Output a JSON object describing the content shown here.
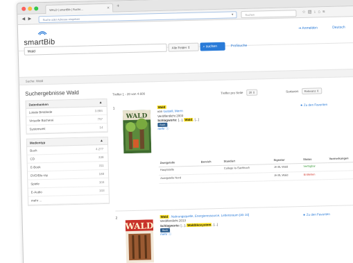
{
  "browser": {
    "tab_title": "WALD | smartBib | Suche...",
    "url_placeholder": "Suche oder Adresse eingeben",
    "search_placeholder": "Suchen"
  },
  "header": {
    "logo_text": "smartBib",
    "links": [
      "Anmelden",
      "Deutsch"
    ]
  },
  "search": {
    "query": "Wald",
    "field": "Alle Felder",
    "button": "suchen",
    "profi_link": "Profisuche"
  },
  "breadcrumb": "Suche: Wald",
  "results": {
    "heading": "Suchergebnisse Wald",
    "hits_info": "Treffer 1 - 20 von 4.600",
    "per_page_label": "Treffer pro Seite",
    "per_page_value": "20",
    "sort_label": "Sortieren",
    "sort_value": "Relevanz"
  },
  "facets": {
    "location": {
      "title": "Datenbanken",
      "items": [
        {
          "label": "Lokale Bestände",
          "count": "3.884"
        },
        {
          "label": "Virtuelle Bücherei",
          "count": "757"
        },
        {
          "label": "Systemweit",
          "count": "14"
        }
      ]
    },
    "media": {
      "title": "Medientyp",
      "items": [
        {
          "label": "Buch",
          "count": "4.277"
        },
        {
          "label": "CD",
          "count": "338"
        },
        {
          "label": "E-Book",
          "count": "311"
        },
        {
          "label": "DVD/Blu-ray",
          "count": "188"
        },
        {
          "label": "Spiele",
          "count": "103"
        },
        {
          "label": "E-Audio",
          "count": "103"
        }
      ],
      "more": "mehr ..."
    }
  },
  "records": [
    {
      "num": "1",
      "cover_text": "WALD",
      "title": "Wald",
      "author_prefix": "von",
      "author": "Gutsell, Merrn",
      "year_line": "Veröffentlicht 2003",
      "subjects_label": "Schlagworte:",
      "subject_pre": "[...], ",
      "subject_hl": "Wald",
      "subject_post": ", [...]",
      "badge": "Buch",
      "more": "mehr",
      "merken": "Zu den Favoriten",
      "holdings": {
        "headers": [
          "Zweigstelle",
          "Bereich",
          "Standort",
          "Signatur",
          "Status",
          "Vormerkungen"
        ],
        "rows": [
          {
            "branch": "Hauptstelle",
            "area": "",
            "location": "College Ie-Sachbuch",
            "callno": "JH 8L Wald",
            "status": "Verfügbar",
            "status_type": "green"
          },
          {
            "branch": "Zweigstelle Nord",
            "area": "",
            "location": "",
            "callno": "JH 8L Wald",
            "status": "Entliehen",
            "status_type": "red"
          }
        ]
      }
    },
    {
      "num": "2",
      "cover_text": "WALD",
      "title_hl": "Wald",
      "title_rest": " : Nahrungsquelle, Energieressource, Lebensraum [Ab 10]",
      "year_line": "Veröffentlicht 2013",
      "subjects_label": "Schlagworte:",
      "subject_pre": "[...], ",
      "subject_hl": "Waldökosystem",
      "subject_post": ", [...]",
      "badge": "Buch",
      "more": "mehr",
      "merken": "Zu den Favoriten"
    }
  ],
  "colors": {
    "accent": "#2a7bd8",
    "highlight": "#ffe21a",
    "status_available": "#3a9a3a",
    "status_lent": "#d43a2f"
  }
}
